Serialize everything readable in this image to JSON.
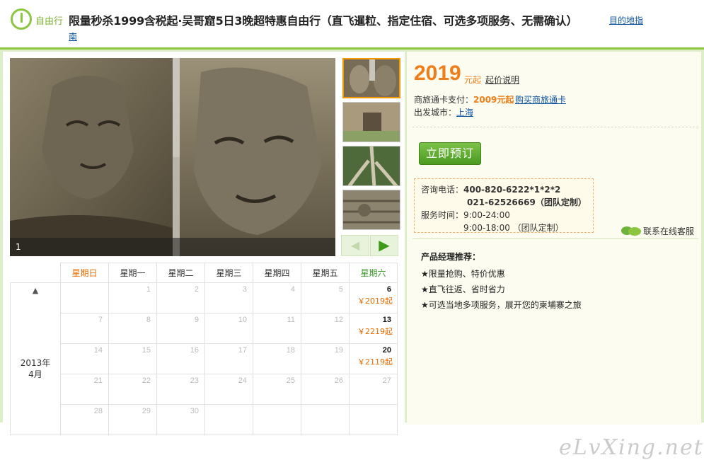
{
  "header": {
    "category_label": "自由行",
    "title": "限量秒杀1999含税起·吴哥窟5日3晚超特惠自由行（直飞暹粒、指定住宿、可选多项服务、无需确认）",
    "guide_link_part1": "目的地指",
    "guide_link_part2": "南"
  },
  "gallery": {
    "caption": "1",
    "prev_label": "◀",
    "next_label": "▶",
    "thumbnails": [
      "bayon-faces",
      "temple-gate",
      "tree-roots",
      "stone-relief"
    ]
  },
  "calendar": {
    "weekdays": [
      "星期日",
      "星期一",
      "星期二",
      "星期三",
      "星期四",
      "星期五",
      "星期六"
    ],
    "year_month": "2013年4月",
    "up_arrow": "▲",
    "weeks": [
      [
        {
          "d": ""
        },
        {
          "d": "1"
        },
        {
          "d": "2"
        },
        {
          "d": "3"
        },
        {
          "d": "4"
        },
        {
          "d": "5"
        },
        {
          "d": "6",
          "price": "￥2019起"
        }
      ],
      [
        {
          "d": "7"
        },
        {
          "d": "8"
        },
        {
          "d": "9"
        },
        {
          "d": "10"
        },
        {
          "d": "11"
        },
        {
          "d": "12"
        },
        {
          "d": "13",
          "price": "￥2219起"
        }
      ],
      [
        {
          "d": "14"
        },
        {
          "d": "15"
        },
        {
          "d": "16"
        },
        {
          "d": "17"
        },
        {
          "d": "18"
        },
        {
          "d": "19"
        },
        {
          "d": "20",
          "price": "￥2119起"
        }
      ],
      [
        {
          "d": "21"
        },
        {
          "d": "22"
        },
        {
          "d": "23"
        },
        {
          "d": "24"
        },
        {
          "d": "25"
        },
        {
          "d": "26"
        },
        {
          "d": "27"
        }
      ],
      [
        {
          "d": "28"
        },
        {
          "d": "29"
        },
        {
          "d": "30"
        },
        {
          "d": ""
        },
        {
          "d": ""
        },
        {
          "d": ""
        },
        {
          "d": ""
        }
      ]
    ]
  },
  "info": {
    "price": "2019",
    "price_unit": "元起",
    "price_note": "起价说明",
    "card_label": "商旅通卡支付：",
    "card_price": "2009元起",
    "card_link": "购买商旅通卡",
    "city_label": "出发城市：",
    "city": "上海",
    "book_button": "立即预订",
    "contact": {
      "phone_label": "咨询电话：",
      "phone1": "400-820-6222*1*2*2",
      "phone2": "021-62526669（团队定制）",
      "hours_label": "服务时间：",
      "hours1": "9:00-24:00",
      "hours2": "9:00-18:00 （团队定制）"
    },
    "online_service": "联系在线客服",
    "recommend_title": "产品经理推荐：",
    "recommend_items": [
      "★限量抢购、特价优惠",
      "★直飞往返、省时省力",
      "★可选当地多项服务，展开您的柬埔寨之旅"
    ]
  },
  "watermark": "eLvXing.net",
  "colors": {
    "accent_green": "#8cc63f",
    "price_orange": "#ef7d1a",
    "link_blue": "#0a52a1"
  }
}
